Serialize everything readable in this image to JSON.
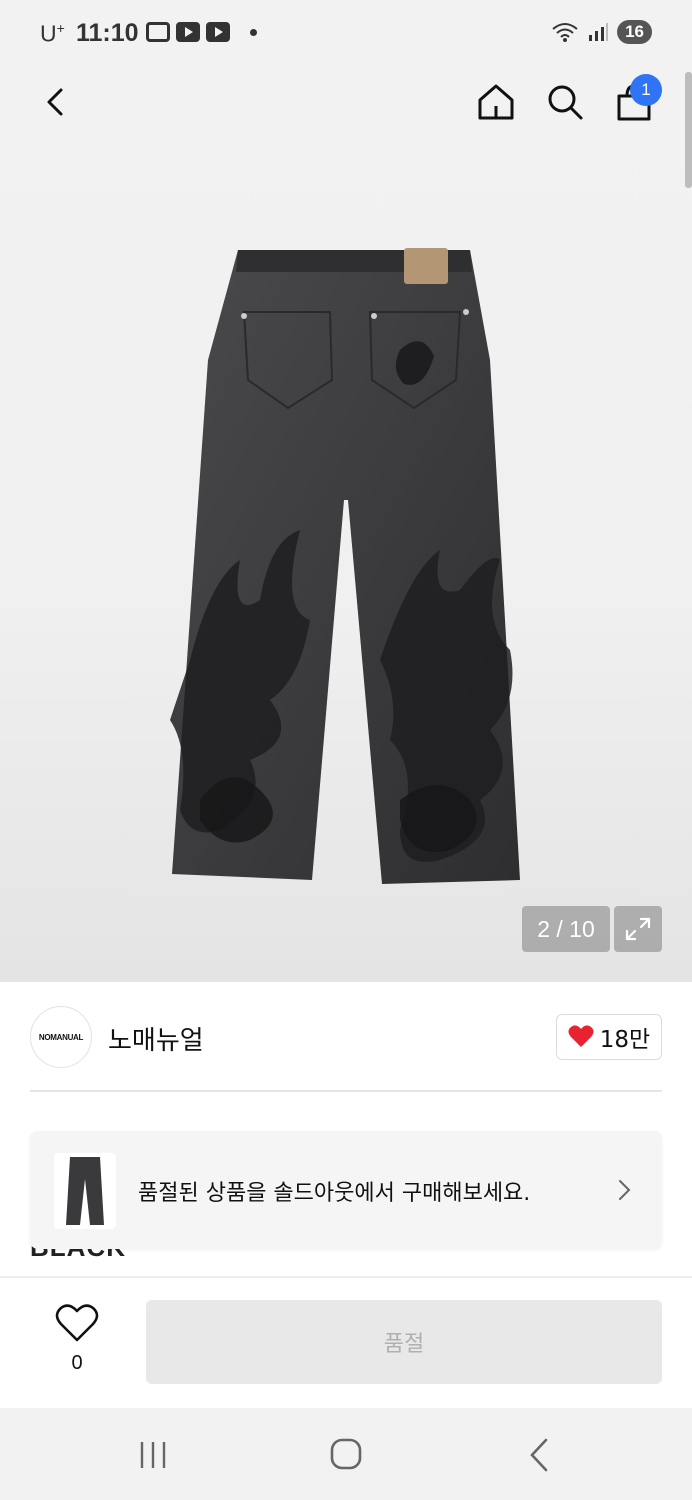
{
  "status_bar": {
    "carrier": "U",
    "carrier_sup": "+",
    "time": "11:10",
    "battery": "16"
  },
  "nav": {
    "cart_count": "1"
  },
  "gallery": {
    "counter": "2 / 10"
  },
  "brand": {
    "logo_text": "NOMANUAL",
    "name": "노매뉴얼",
    "likes": "18만"
  },
  "product": {
    "title_fragment": "BLACK"
  },
  "banner": {
    "text": "품절된 상품을 솔드아웃에서 구매해보세요."
  },
  "action_bar": {
    "wish_count": "0",
    "buy_label": "품절"
  },
  "colors": {
    "badge": "#2f74f5",
    "heart": "#e8232f",
    "button_disabled": "#e8e8e8"
  }
}
